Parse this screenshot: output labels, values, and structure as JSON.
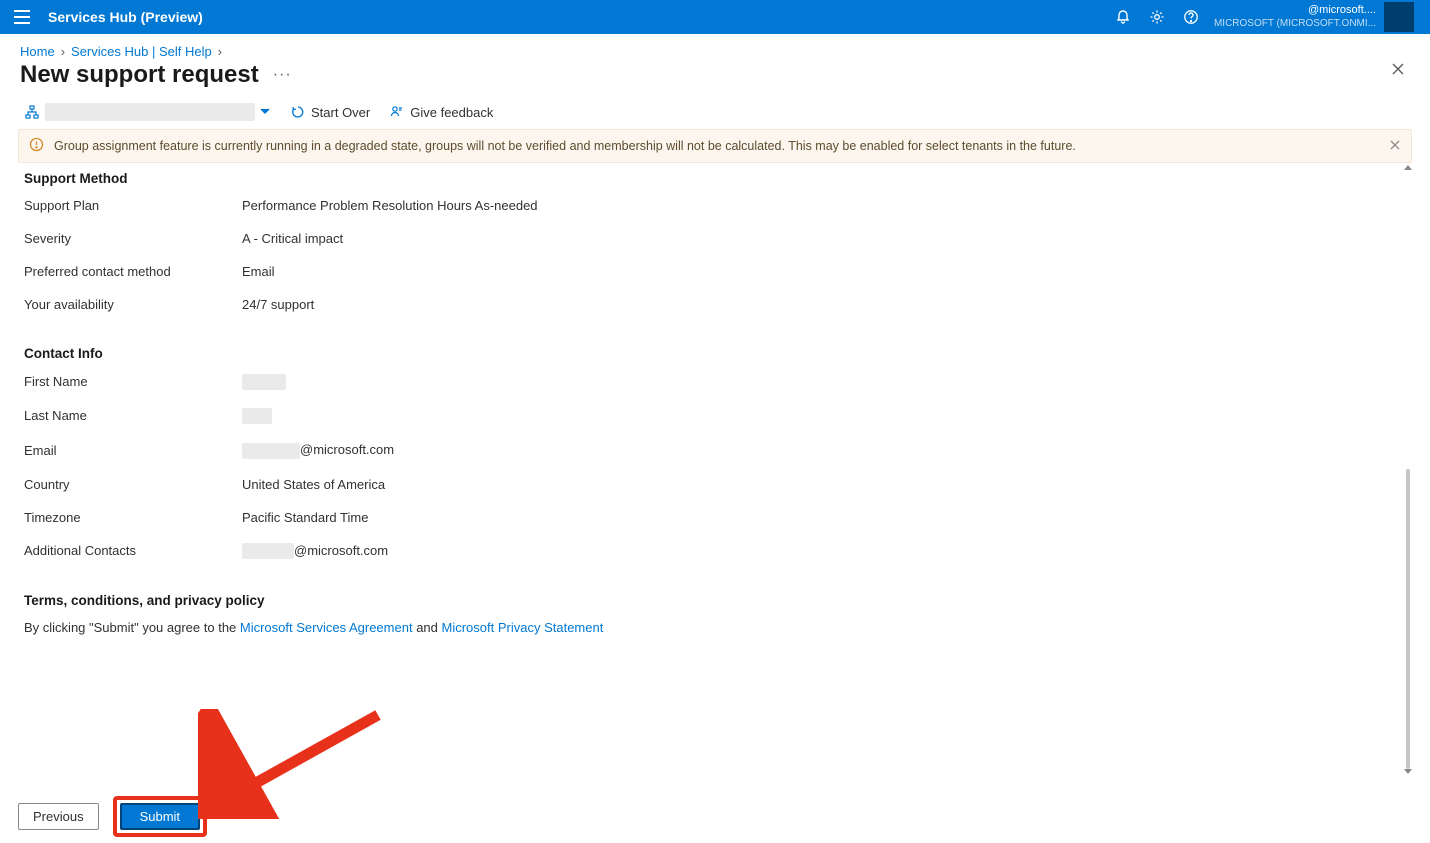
{
  "header": {
    "brand": "Services Hub (Preview)",
    "account_email": "@microsoft....",
    "account_tenant": "MICROSOFT (MICROSOFT.ONMI..."
  },
  "breadcrumb": {
    "home": "Home",
    "services": "Services Hub | Self Help"
  },
  "page": {
    "title": "New support request"
  },
  "toolbar": {
    "start_over": "Start Over",
    "give_feedback": "Give feedback"
  },
  "warning": {
    "text": "Group assignment feature is currently running in a degraded state, groups will not be verified and membership will not be calculated. This may be enabled for select tenants in the future."
  },
  "sections": {
    "support_method": {
      "title": "Support Method",
      "rows": {
        "support_plan_label": "Support Plan",
        "support_plan_value": "Performance Problem Resolution Hours As-needed",
        "severity_label": "Severity",
        "severity_value": "A - Critical impact",
        "contact_method_label": "Preferred contact method",
        "contact_method_value": "Email",
        "availability_label": "Your availability",
        "availability_value": "24/7 support"
      }
    },
    "contact_info": {
      "title": "Contact Info",
      "rows": {
        "first_name_label": "First Name",
        "last_name_label": "Last Name",
        "email_label": "Email",
        "email_suffix": "@microsoft.com",
        "country_label": "Country",
        "country_value": "United States of America",
        "timezone_label": "Timezone",
        "timezone_value": "Pacific Standard Time",
        "additional_contacts_label": "Additional Contacts",
        "additional_contacts_suffix": "@microsoft.com"
      }
    },
    "terms": {
      "title": "Terms, conditions, and privacy policy",
      "prefix": "By clicking \"Submit\" you agree to the ",
      "link1": "Microsoft Services Agreement",
      "mid": " and ",
      "link2": "Microsoft Privacy Statement"
    }
  },
  "footer": {
    "previous": "Previous",
    "submit": "Submit"
  }
}
